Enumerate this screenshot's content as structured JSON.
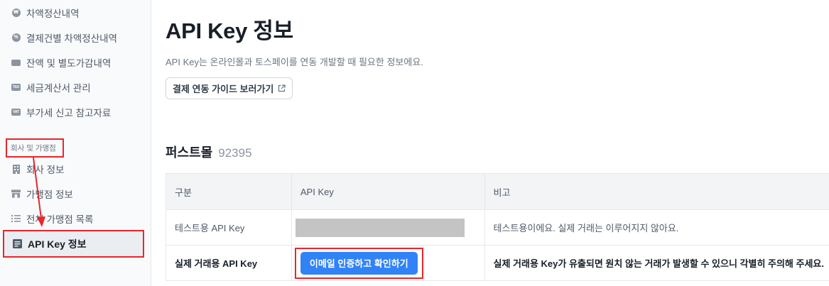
{
  "sidebar": {
    "items": [
      {
        "label": "차액정산내역",
        "icon": "coin-icon",
        "icon_text": "₩"
      },
      {
        "label": "결제건별 차액정산내역",
        "icon": "coin-percent-icon",
        "icon_text": "%"
      },
      {
        "label": "잔액 및 별도가감내역",
        "icon": "card-icon",
        "icon_text": ""
      },
      {
        "label": "세금계산서 관리",
        "icon": "tax-icon",
        "icon_text": "TAX"
      },
      {
        "label": "부가세 신고 참고자료",
        "icon": "vat-icon",
        "icon_text": "VAT"
      }
    ],
    "section_label": "회사 및 가맹점",
    "company_items": [
      {
        "label": "회사 정보",
        "icon": "building-icon"
      },
      {
        "label": "가맹점 정보",
        "icon": "store-icon"
      },
      {
        "label": "전체 가맹점 목록",
        "icon": "list-icon"
      }
    ],
    "active_item": {
      "label": "API Key 정보",
      "icon": "api-doc-icon"
    }
  },
  "main": {
    "title": "API Key 정보",
    "description": "API Key는 온라인몰과 토스페이를 연동 개발할 때 필요한 정보에요.",
    "guide_button": "결제 연동 가이드 보러가기",
    "store": {
      "name": "퍼스트몰",
      "id": "92395"
    },
    "table": {
      "headers": [
        "구분",
        "API Key",
        "비고"
      ],
      "rows": [
        {
          "type": "테스트용 API Key",
          "note": "테스트용이에요. 실제 거래는 이루어지지 않아요."
        },
        {
          "type": "실제 거래용 API Key",
          "button": "이메일 인증하고 확인하기",
          "note": "실제 거래용 Key가 유출되면 원치 않는 거래가 발생할 수 있으니 각별히 주의해 주세요."
        }
      ]
    }
  },
  "colors": {
    "accent": "#3182f6",
    "highlight": "#e8262c",
    "sidebar_bg": "#f9fafb"
  }
}
